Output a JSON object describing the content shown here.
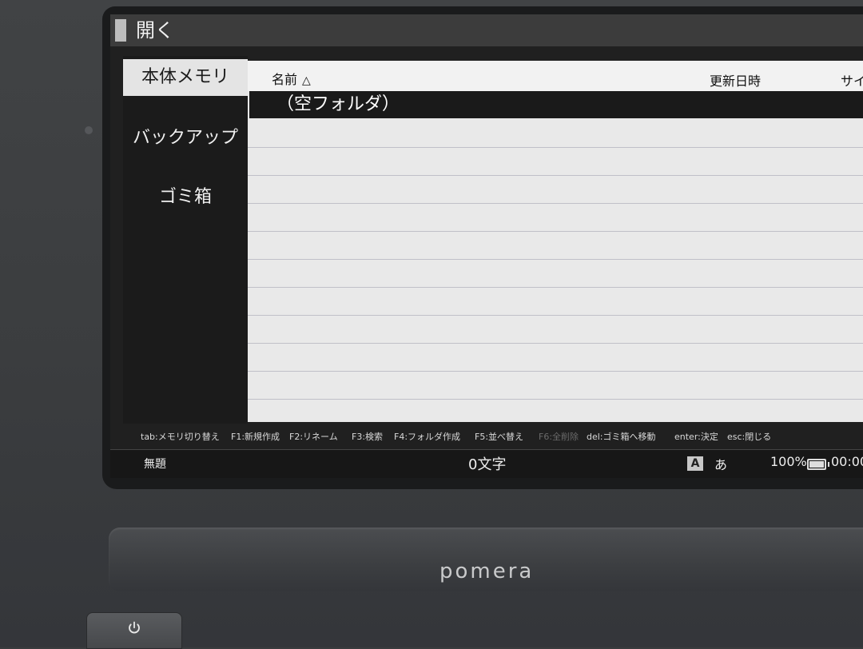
{
  "window": {
    "title": "開く"
  },
  "nav": {
    "items": [
      {
        "label": "本体メモリ",
        "active": true
      },
      {
        "label": "バックアップ",
        "active": false
      },
      {
        "label": "ゴミ箱",
        "active": false
      }
    ]
  },
  "list": {
    "columns": {
      "name": "名前",
      "date": "更新日時",
      "size": "サイ"
    },
    "sort_indicator": "△",
    "selected_row": "（空フォルダ）"
  },
  "hints": [
    {
      "text": "tab:メモリ切り替え",
      "disabled": false
    },
    {
      "text": "F1:新規作成",
      "disabled": false
    },
    {
      "text": "F2:リネーム",
      "disabled": false
    },
    {
      "text": "F3:検索",
      "disabled": false
    },
    {
      "text": "F4:フォルダ作成",
      "disabled": false
    },
    {
      "text": "F5:並べ替え",
      "disabled": false
    },
    {
      "text": "F6:全削除",
      "disabled": true
    },
    {
      "text": "del:ゴミ箱へ移動",
      "disabled": false
    },
    {
      "text": "enter:決定",
      "disabled": false
    },
    {
      "text": "esc:閉じる",
      "disabled": false
    }
  ],
  "status": {
    "document": "無題",
    "char_count": "0文字",
    "ime_icon": "A",
    "ime_mode": "あ",
    "battery": "100%",
    "time": "00:00"
  },
  "device": {
    "brand": "pomera"
  },
  "icons": {
    "power": "power-icon",
    "battery": "battery-icon",
    "sort": "sort-ascending-icon"
  }
}
